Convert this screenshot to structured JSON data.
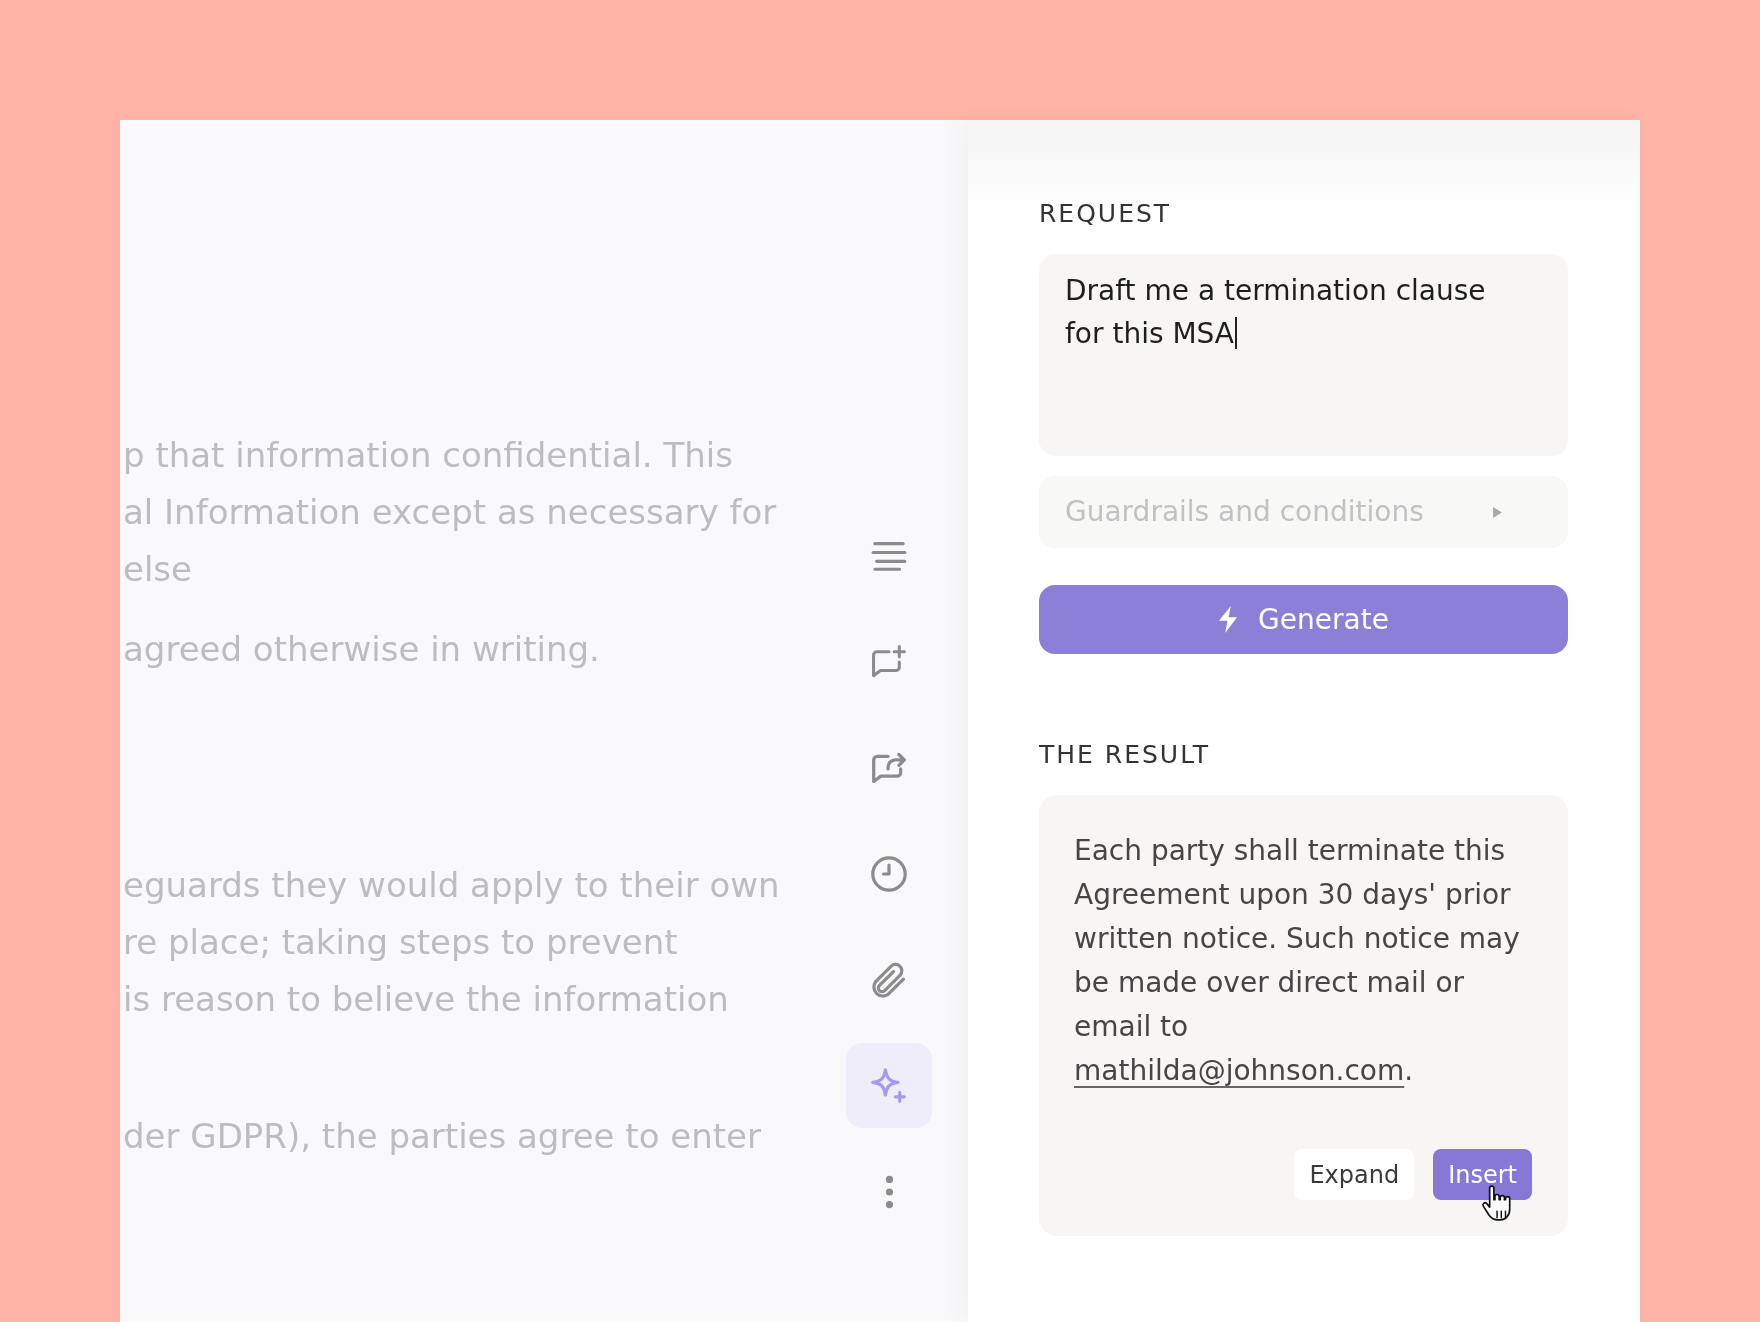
{
  "document": {
    "paragraphs": [
      {
        "lines": [
          "p that information confidential. This",
          "al Information except as necessary for",
          "else"
        ]
      },
      {
        "lines": [
          "agreed otherwise in writing."
        ]
      },
      {
        "lines": [
          "eguards they would apply to their own",
          "re place; taking steps to prevent",
          "is reason to believe the information"
        ]
      },
      {
        "lines": [
          "der GDPR), the parties agree to enter"
        ]
      }
    ]
  },
  "toolbar": [
    {
      "selected": false
    },
    {
      "selected": false
    },
    {
      "selected": false
    },
    {
      "selected": false
    },
    {
      "selected": false
    },
    {
      "selected": true
    },
    {
      "selected": false
    }
  ],
  "request": {
    "heading": "REQUEST",
    "value": "Draft me a termination clause for this MSA",
    "focused": true
  },
  "guardrails": {
    "label": "Guardrails and conditions",
    "expanded": false
  },
  "generate": {
    "label": "Generate"
  },
  "result": {
    "heading": "THE RESULT",
    "lines": [
      "Each party shall terminate this",
      "Agreement upon 30 days' prior",
      "written notice. Such notice may",
      "be made over direct mail or",
      "email to"
    ],
    "link": "mathilda@johnson.com",
    "after_link": ".",
    "buttons": [
      {
        "label": "Expand",
        "kind": "secondary",
        "hovered": false
      },
      {
        "label": "Insert",
        "kind": "primary",
        "hovered": true
      }
    ]
  }
}
